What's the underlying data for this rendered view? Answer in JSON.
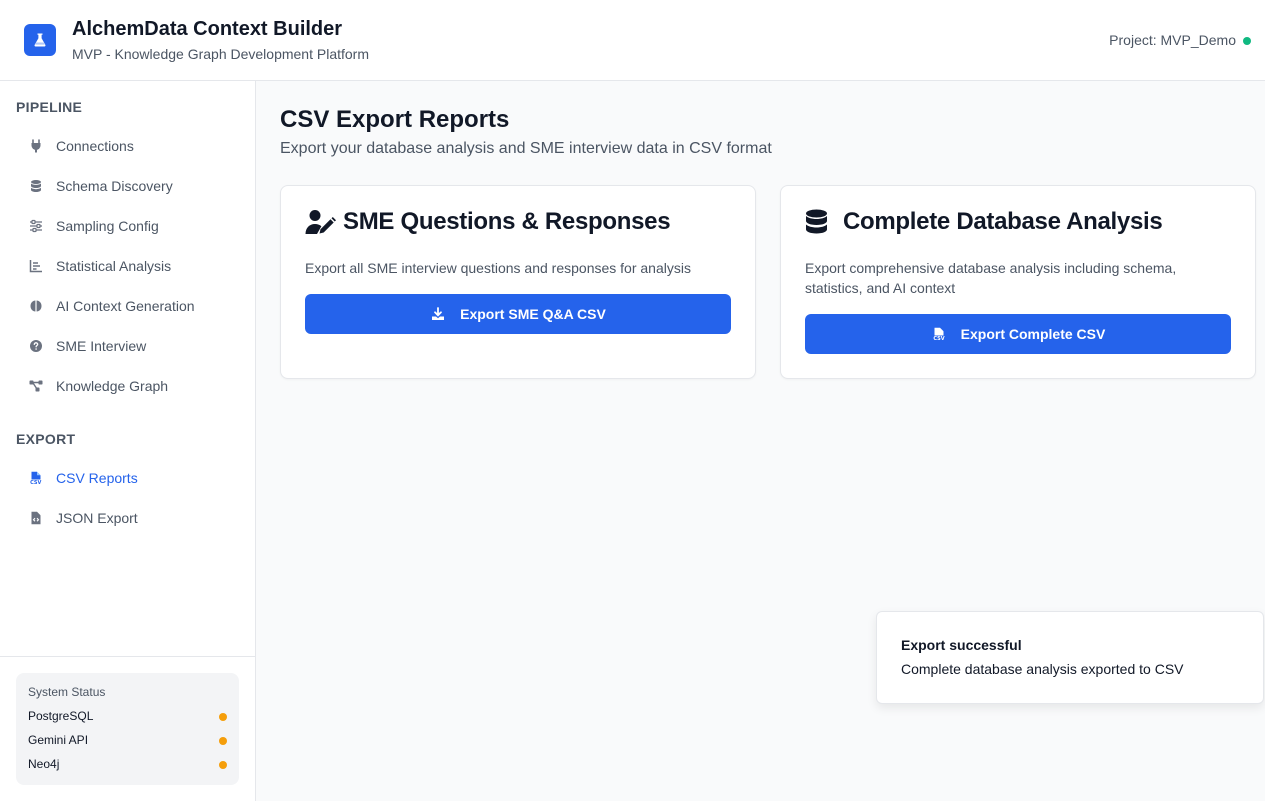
{
  "header": {
    "logo_icon": "flask-icon",
    "title": "AlchemData Context Builder",
    "subtitle": "MVP - Knowledge Graph Development Platform",
    "project": "Project: MVP_Demo",
    "project_status_color": "#10b981"
  },
  "sidebar": {
    "pipeline_label": "PIPELINE",
    "pipeline_items": [
      {
        "label": "Connections",
        "icon": "plug-icon"
      },
      {
        "label": "Schema Discovery",
        "icon": "database-icon"
      },
      {
        "label": "Sampling Config",
        "icon": "sliders-icon"
      },
      {
        "label": "Statistical Analysis",
        "icon": "chart-icon"
      },
      {
        "label": "AI Context Generation",
        "icon": "brain-icon"
      },
      {
        "label": "SME Interview",
        "icon": "question-icon"
      },
      {
        "label": "Knowledge Graph",
        "icon": "graph-icon"
      }
    ],
    "export_label": "EXPORT",
    "export_items": [
      {
        "label": "CSV Reports",
        "icon": "csv-file-icon",
        "active": true
      },
      {
        "label": "JSON Export",
        "icon": "code-file-icon",
        "active": false
      }
    ],
    "status": {
      "title": "System Status",
      "items": [
        {
          "label": "PostgreSQL",
          "color": "#f59e0b"
        },
        {
          "label": "Gemini API",
          "color": "#f59e0b"
        },
        {
          "label": "Neo4j",
          "color": "#f59e0b"
        }
      ]
    }
  },
  "main": {
    "title": "CSV Export Reports",
    "subtitle": "Export your database analysis and SME interview data in CSV format",
    "cards": [
      {
        "title": "SME Questions & Responses",
        "icon": "user-edit-icon",
        "description": "Export all SME interview questions and responses for analysis",
        "button_label": "Export SME Q&A CSV",
        "button_icon": "download-icon"
      },
      {
        "title": "Complete Database Analysis",
        "icon": "database-icon",
        "description": "Export comprehensive database analysis including schema, statistics, and AI context",
        "button_label": "Export Complete CSV",
        "button_icon": "csv-file-icon"
      }
    ]
  },
  "toast": {
    "title": "Export successful",
    "message": "Complete database analysis exported to CSV"
  },
  "colors": {
    "accent": "#2563eb"
  }
}
